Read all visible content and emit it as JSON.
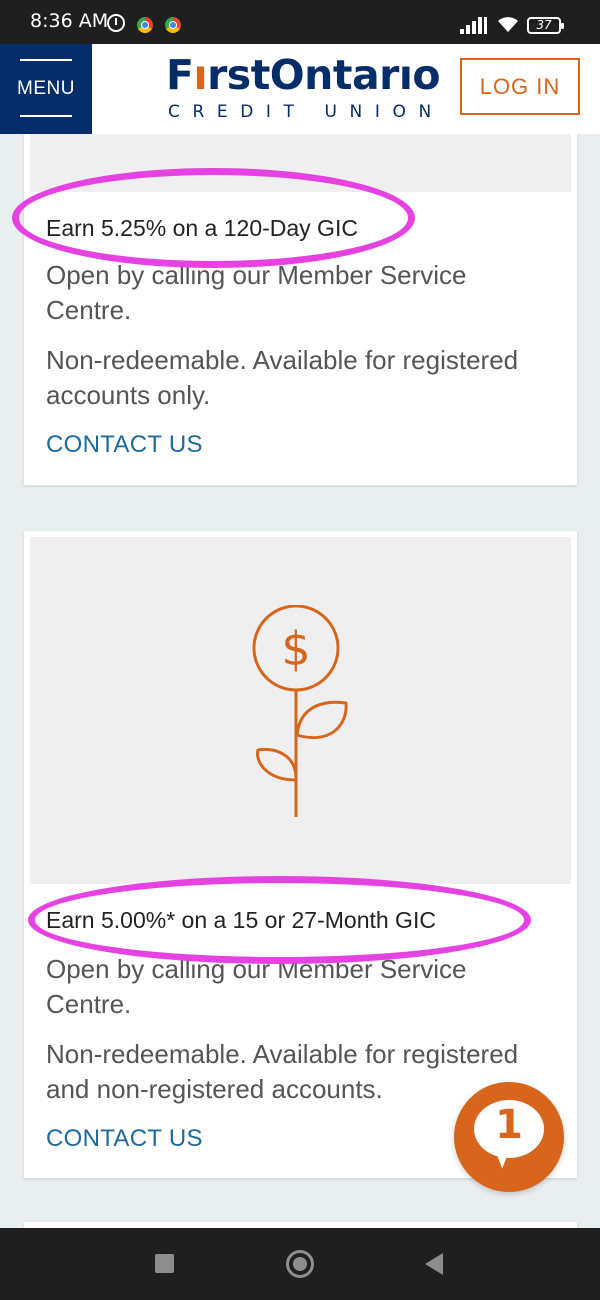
{
  "status_bar": {
    "time": "8:36 AM",
    "battery": "37",
    "icons": [
      "alarm-icon",
      "chrome-icon",
      "chrome-icon",
      "signal-icon",
      "wifi-icon",
      "battery-icon"
    ]
  },
  "header": {
    "menu_label": "MENU",
    "logo_main_pre": "F",
    "logo_main_accent": "ı",
    "logo_main_post": "rstOntarıo",
    "logo_sub": "CREDIT UNION",
    "login_label": "LOG IN"
  },
  "cards": [
    {
      "title": "Earn 5.25% on a 120-Day GIC",
      "text1": "Open by calling our Member Service Centre.",
      "text2": "Non-redeemable. Available for registered accounts only.",
      "link": "CONTACT US"
    },
    {
      "title": "Earn 5.00%* on a 15 or 27-Month GIC",
      "text1": "Open by calling our Member Service Centre.",
      "text2": "Non-redeemable. Available for registered and non-registered accounts.",
      "link": "CONTACT US",
      "image_icon": "money-plant-icon"
    }
  ],
  "chat": {
    "count": "1"
  },
  "colors": {
    "brand_navy": "#052d69",
    "brand_orange": "#d8651c",
    "link_blue": "#1f6a9a",
    "highlight_magenta": "#e642e2"
  },
  "nav_bar": {
    "buttons": [
      "recents-button",
      "home-button",
      "back-button"
    ]
  }
}
